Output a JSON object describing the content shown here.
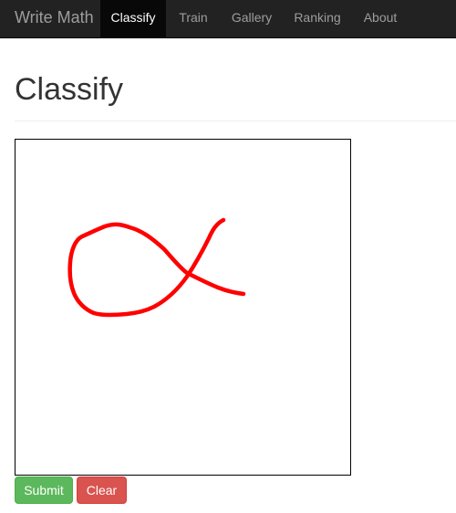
{
  "navbar": {
    "brand": "Write Math",
    "items": [
      {
        "label": "Classify",
        "active": true
      },
      {
        "label": "Train",
        "active": false
      },
      {
        "label": "Gallery",
        "active": false
      },
      {
        "label": "Ranking",
        "active": false
      },
      {
        "label": "About",
        "active": false
      }
    ]
  },
  "page": {
    "title": "Classify"
  },
  "drawing": {
    "stroke_color": "#ff0000",
    "background_color": "#ffffff",
    "border_color": "#000000"
  },
  "actions": {
    "submit_label": "Submit",
    "clear_label": "Clear"
  },
  "colors": {
    "navbar_bg": "#222222",
    "nav_active_bg": "#080808",
    "submit_green": "#5cb85c",
    "clear_red": "#d9534f"
  }
}
